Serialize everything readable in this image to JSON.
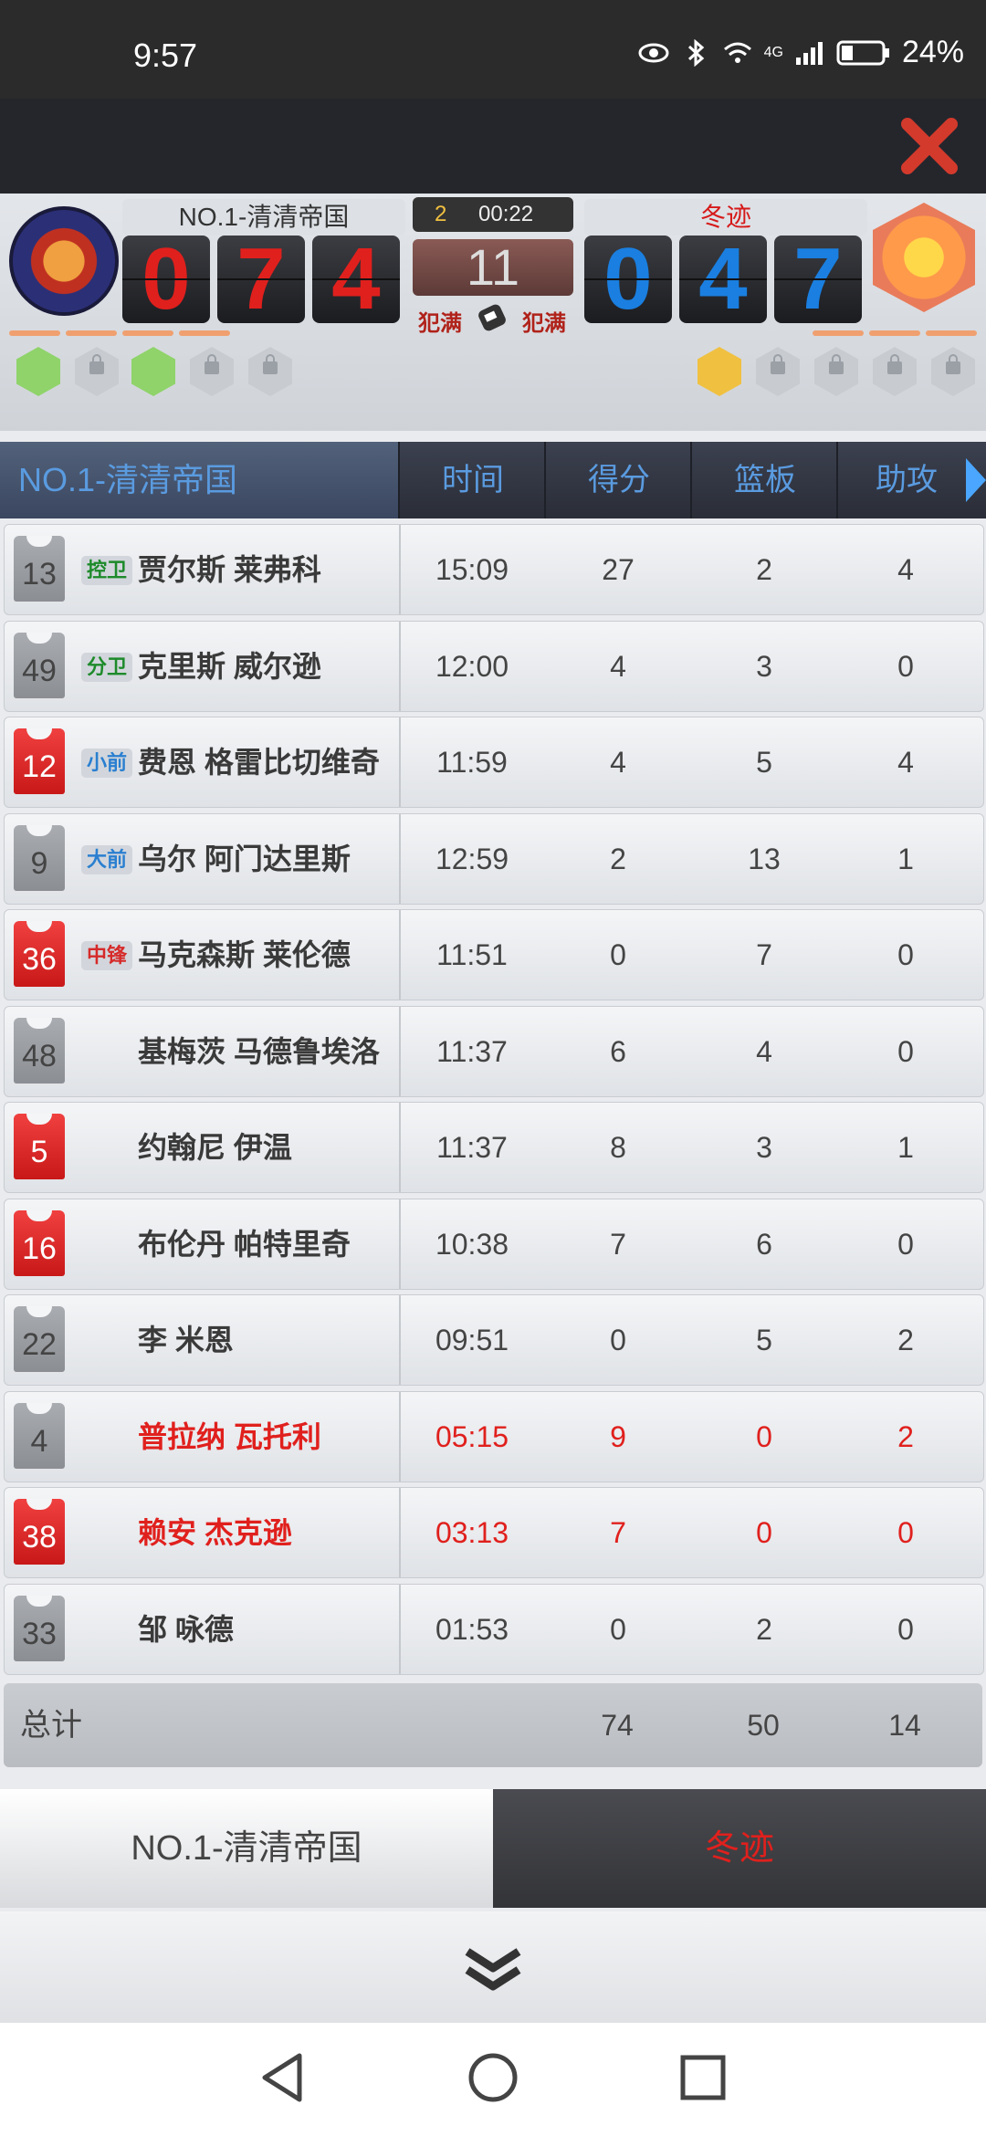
{
  "status_bar": {
    "time": "9:57",
    "battery": "24%",
    "network": "4G"
  },
  "scoreboard": {
    "home_team": "NO.1-清清帝国",
    "away_team": "冬迹",
    "home_digits": [
      "0",
      "7",
      "4"
    ],
    "away_digits": [
      "0",
      "4",
      "7"
    ],
    "period": "2",
    "clock": "00:22",
    "shot_clock": "11",
    "home_foul": "犯满",
    "away_foul": "犯满"
  },
  "table": {
    "team_header": "NO.1-清清帝国",
    "columns": [
      "时间",
      "得分",
      "篮板",
      "助攻"
    ],
    "rows": [
      {
        "number": "13",
        "jersey": "gray",
        "position": "控卫",
        "pos_class": "g",
        "name": "贾尔斯 莱弗科",
        "time": "15:09",
        "points": "27",
        "rebounds": "2",
        "assists": "4"
      },
      {
        "number": "49",
        "jersey": "gray",
        "position": "分卫",
        "pos_class": "g",
        "name": "克里斯 威尔逊",
        "time": "12:00",
        "points": "4",
        "rebounds": "3",
        "assists": "0"
      },
      {
        "number": "12",
        "jersey": "red",
        "position": "小前",
        "pos_class": "f",
        "name": "费恩 格雷比切维奇",
        "time": "11:59",
        "points": "4",
        "rebounds": "5",
        "assists": "4"
      },
      {
        "number": "9",
        "jersey": "gray",
        "position": "大前",
        "pos_class": "f",
        "name": "乌尔 阿门达里斯",
        "time": "12:59",
        "points": "2",
        "rebounds": "13",
        "assists": "1"
      },
      {
        "number": "36",
        "jersey": "red",
        "position": "中锋",
        "pos_class": "c",
        "name": "马克森斯 莱伦德",
        "time": "11:51",
        "points": "0",
        "rebounds": "7",
        "assists": "0"
      },
      {
        "number": "48",
        "jersey": "gray",
        "position": "",
        "pos_class": "",
        "name": "基梅茨 马德鲁埃洛",
        "time": "11:37",
        "points": "6",
        "rebounds": "4",
        "assists": "0"
      },
      {
        "number": "5",
        "jersey": "red",
        "position": "",
        "pos_class": "",
        "name": "约翰尼 伊温",
        "time": "11:37",
        "points": "8",
        "rebounds": "3",
        "assists": "1"
      },
      {
        "number": "16",
        "jersey": "red",
        "position": "",
        "pos_class": "",
        "name": "布伦丹 帕特里奇",
        "time": "10:38",
        "points": "7",
        "rebounds": "6",
        "assists": "0"
      },
      {
        "number": "22",
        "jersey": "gray",
        "position": "",
        "pos_class": "",
        "name": "李 米恩",
        "time": "09:51",
        "points": "0",
        "rebounds": "5",
        "assists": "2"
      },
      {
        "number": "4",
        "jersey": "gray",
        "position": "",
        "pos_class": "",
        "name": "普拉纳 瓦托利",
        "time": "05:15",
        "points": "9",
        "rebounds": "0",
        "assists": "2",
        "highlight": true
      },
      {
        "number": "38",
        "jersey": "red",
        "position": "",
        "pos_class": "",
        "name": "赖安 杰克逊",
        "time": "03:13",
        "points": "7",
        "rebounds": "0",
        "assists": "0",
        "highlight": true
      },
      {
        "number": "33",
        "jersey": "gray",
        "position": "",
        "pos_class": "",
        "name": "邹 咏德",
        "time": "01:53",
        "points": "0",
        "rebounds": "2",
        "assists": "0"
      }
    ],
    "totals": {
      "label": "总计",
      "points": "74",
      "rebounds": "50",
      "assists": "14"
    }
  },
  "tabs": {
    "home": "NO.1-清清帝国",
    "away": "冬迹"
  },
  "colors": {
    "accent_red": "#e0201d",
    "accent_blue": "#1a7fe0",
    "header_blue": "#5a9be0"
  }
}
